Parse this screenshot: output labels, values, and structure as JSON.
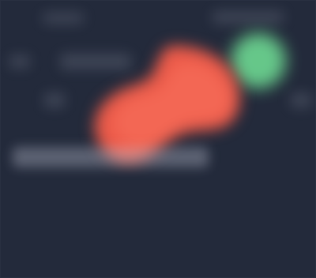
{
  "screen": {
    "title": "",
    "accent_color": "#ec5a49",
    "status_color": "#6ad08e",
    "background": "#232a3b"
  },
  "header": {
    "left_label": "",
    "right_label": ""
  },
  "content": {
    "headline": "",
    "body": ""
  },
  "icons": {
    "left": "chevron-left-icon",
    "right": "chevron-right-icon",
    "status": "status-dot-icon"
  }
}
